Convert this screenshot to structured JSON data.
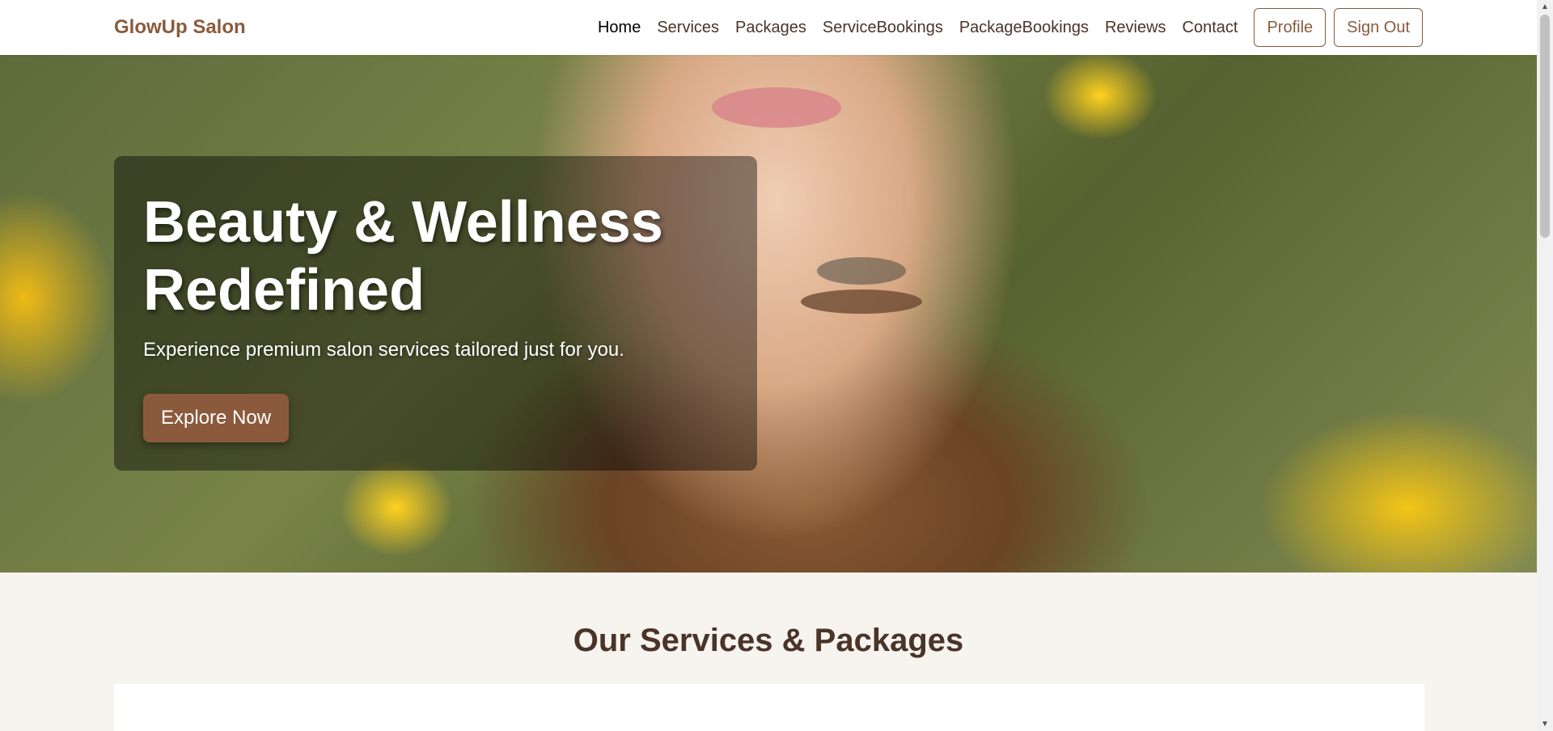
{
  "navbar": {
    "brand": "GlowUp Salon",
    "links": [
      {
        "label": "Home",
        "active": true
      },
      {
        "label": "Services"
      },
      {
        "label": "Packages"
      },
      {
        "label": "ServiceBookings"
      },
      {
        "label": "PackageBookings"
      },
      {
        "label": "Reviews"
      },
      {
        "label": "Contact"
      }
    ],
    "profile_label": "Profile",
    "signout_label": "Sign Out"
  },
  "hero": {
    "title": "Beauty & Wellness Redefined",
    "subtitle": "Experience premium salon services tailored just for you.",
    "cta_label": "Explore Now"
  },
  "services_section": {
    "title": "Our Services & Packages"
  },
  "colors": {
    "brand": "#8b5a3c",
    "text_dark": "#4a3428",
    "section_bg": "#f7f3ee"
  },
  "scrollbar": {
    "up_icon": "chevron-up-icon",
    "down_icon": "chevron-down-icon"
  }
}
